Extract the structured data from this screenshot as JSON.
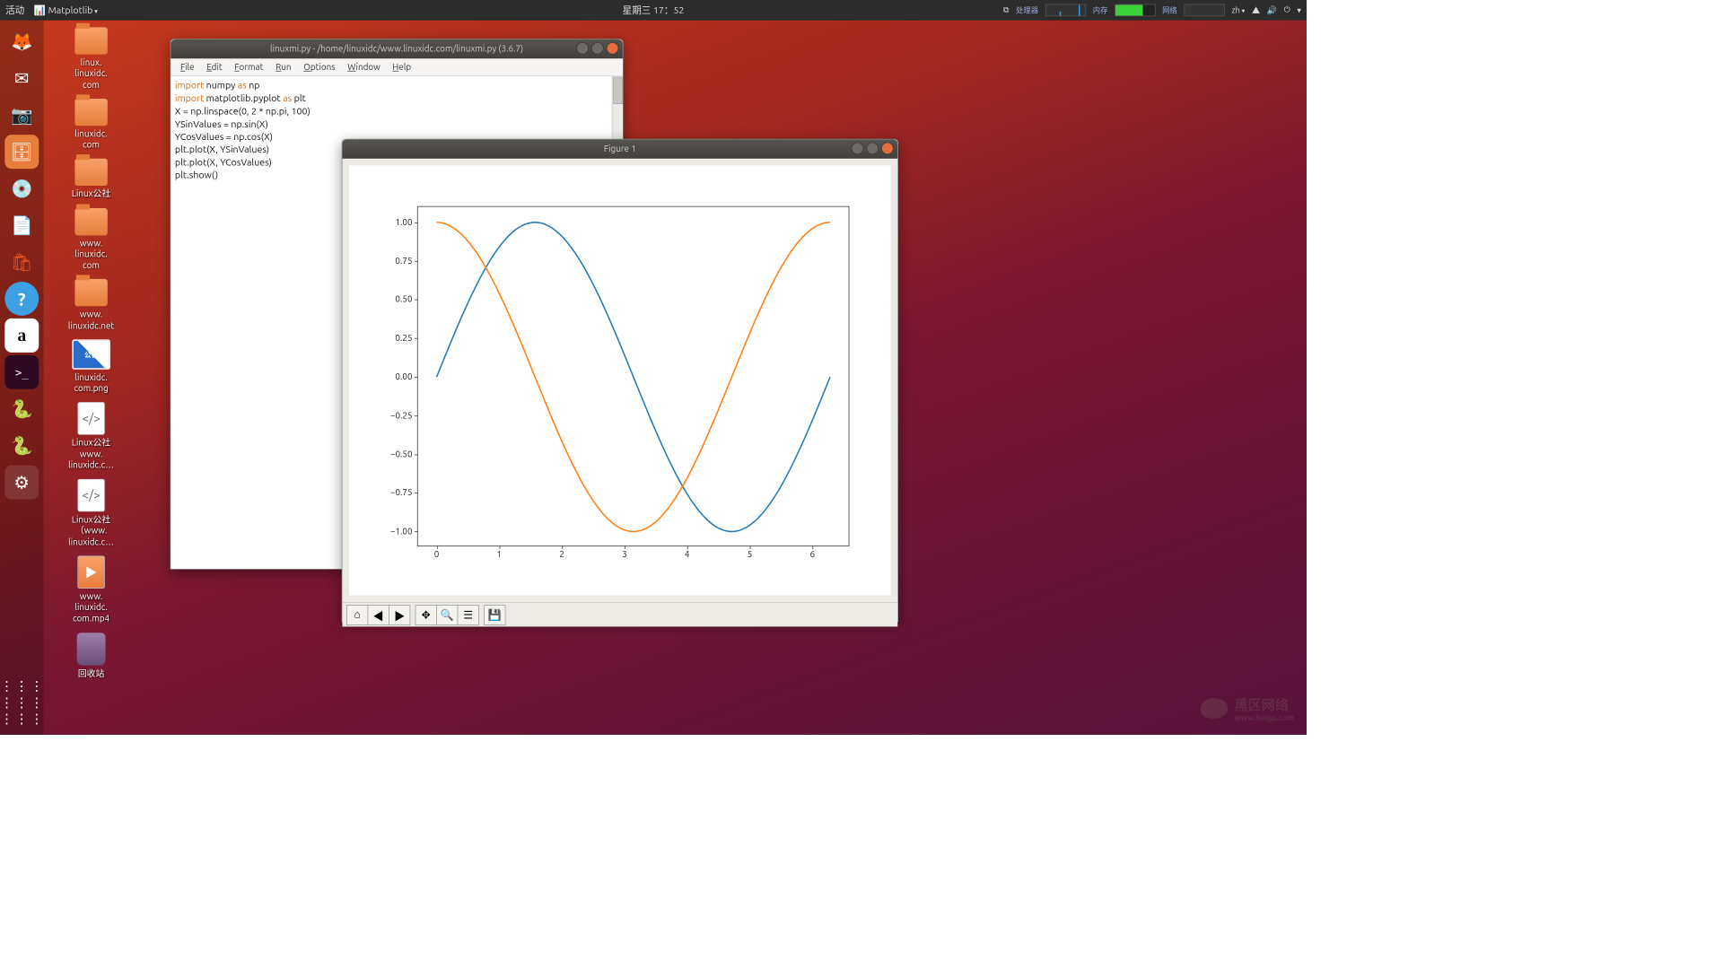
{
  "topbar": {
    "activities": "活动",
    "app": "Matplotlib",
    "clock": "星期三 17：52",
    "ind": {
      "cpu": "处理器",
      "mem": "内存",
      "net": "网络"
    },
    "lang": "zh"
  },
  "dock": [
    {
      "name": "firefox",
      "glyph": "🦊"
    },
    {
      "name": "thunderbird",
      "glyph": "✉"
    },
    {
      "name": "camera",
      "glyph": "📷"
    },
    {
      "name": "files",
      "glyph": "🗄"
    },
    {
      "name": "rhythmbox",
      "glyph": "💿"
    },
    {
      "name": "libreoffice",
      "glyph": "📄"
    },
    {
      "name": "software",
      "glyph": "🛍"
    },
    {
      "name": "help",
      "glyph": "?"
    },
    {
      "name": "amazon",
      "glyph": "a"
    },
    {
      "name": "terminal",
      "glyph": ">_"
    },
    {
      "name": "python1",
      "glyph": "🐍"
    },
    {
      "name": "python2",
      "glyph": "🐍"
    },
    {
      "name": "settings",
      "glyph": "⚙"
    }
  ],
  "desktop_icons": [
    {
      "type": "folder",
      "label": "linux.\nlinuxidc.\ncom"
    },
    {
      "type": "folder",
      "label": "linuxidc.\ncom"
    },
    {
      "type": "folder",
      "label": "Linux公社"
    },
    {
      "type": "folder",
      "label": "www.\nlinuxidc.\ncom"
    },
    {
      "type": "folder",
      "label": "www.\nlinuxidc.net"
    },
    {
      "type": "image",
      "label": "linuxidc.\ncom.png"
    },
    {
      "type": "file",
      "label": "Linux公社\nwww.\nlinuxidc.c…"
    },
    {
      "type": "file",
      "label": "Linux公社\n（www.\nlinuxidc.c…"
    },
    {
      "type": "video",
      "label": "www.\nlinuxidc.\ncom.mp4"
    },
    {
      "type": "trash",
      "label": "回收站"
    }
  ],
  "editor": {
    "title": "linuxmi.py - /home/linuxidc/www.linuxidc.com/linuxmi.py (3.6.7)",
    "menus": [
      "File",
      "Edit",
      "Format",
      "Run",
      "Options",
      "Window",
      "Help"
    ],
    "code_lines": [
      {
        "t": [
          {
            "c": "kw",
            "s": "import"
          },
          {
            "s": " numpy "
          },
          {
            "c": "kw",
            "s": "as"
          },
          {
            "s": " np"
          }
        ]
      },
      {
        "t": [
          {
            "c": "kw",
            "s": "import"
          },
          {
            "s": " matplotlib.pyplot "
          },
          {
            "c": "kw",
            "s": "as"
          },
          {
            "s": " plt"
          }
        ]
      },
      {
        "t": [
          {
            "s": "X = np.linspace(0, 2 * np.pi, 100)"
          }
        ]
      },
      {
        "t": [
          {
            "s": "YSinValues = np.sin(X)"
          }
        ]
      },
      {
        "t": [
          {
            "s": "YCosValues = np.cos(X)"
          }
        ]
      },
      {
        "t": [
          {
            "s": "plt.plot(X, YSinValues)"
          }
        ]
      },
      {
        "t": [
          {
            "s": "plt.plot(X, YCosValues)"
          }
        ]
      },
      {
        "t": [
          {
            "s": "plt.show()"
          }
        ]
      }
    ]
  },
  "figure": {
    "title": "Figure 1",
    "toolbar": [
      "home",
      "back",
      "forward",
      "|",
      "pan",
      "zoom",
      "config",
      "|",
      "save"
    ],
    "glyphs": {
      "home": "⌂",
      "back": "◀",
      "forward": "▶",
      "pan": "✥",
      "zoom": "🔍",
      "config": "☰",
      "save": "💾"
    }
  },
  "chart_data": {
    "type": "line",
    "x_range": [
      0,
      6.283185
    ],
    "series": [
      {
        "name": "sin",
        "color": "#1f77b4",
        "fn": "sin"
      },
      {
        "name": "cos",
        "color": "#ff7f0e",
        "fn": "cos"
      }
    ],
    "xticks": [
      0,
      1,
      2,
      3,
      4,
      5,
      6
    ],
    "yticks": [
      -1.0,
      -0.75,
      -0.5,
      -0.25,
      0.0,
      0.25,
      0.5,
      0.75,
      1.0
    ],
    "xlim": [
      -0.3,
      6.6
    ],
    "ylim": [
      -1.1,
      1.1
    ],
    "n_points": 100
  },
  "watermark": {
    "text": "黑区网络",
    "sub": "www.heiqu.com"
  }
}
